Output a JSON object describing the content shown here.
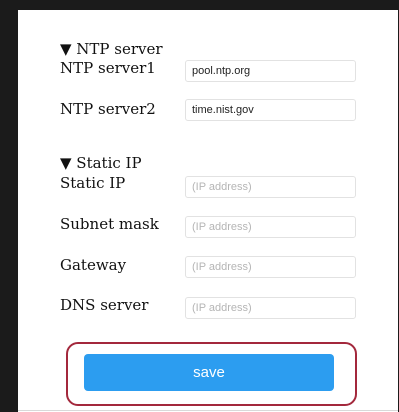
{
  "ntp_section": {
    "title": "▼ NTP server",
    "server1_label": "NTP server1",
    "server1_value": "pool.ntp.org",
    "server2_label": "NTP server2",
    "server2_value": "time.nist.gov"
  },
  "static_ip_section": {
    "title": "▼ Static IP",
    "static_ip_label": "Static IP",
    "static_ip_placeholder": "(IP address)",
    "subnet_label": "Subnet mask",
    "subnet_placeholder": "(IP address)",
    "gateway_label": "Gateway",
    "gateway_placeholder": "(IP address)",
    "dns_label": "DNS server",
    "dns_placeholder": "(IP address)"
  },
  "actions": {
    "save_label": "save"
  },
  "colors": {
    "button": "#2c9df0",
    "highlight": "#a3283c"
  }
}
